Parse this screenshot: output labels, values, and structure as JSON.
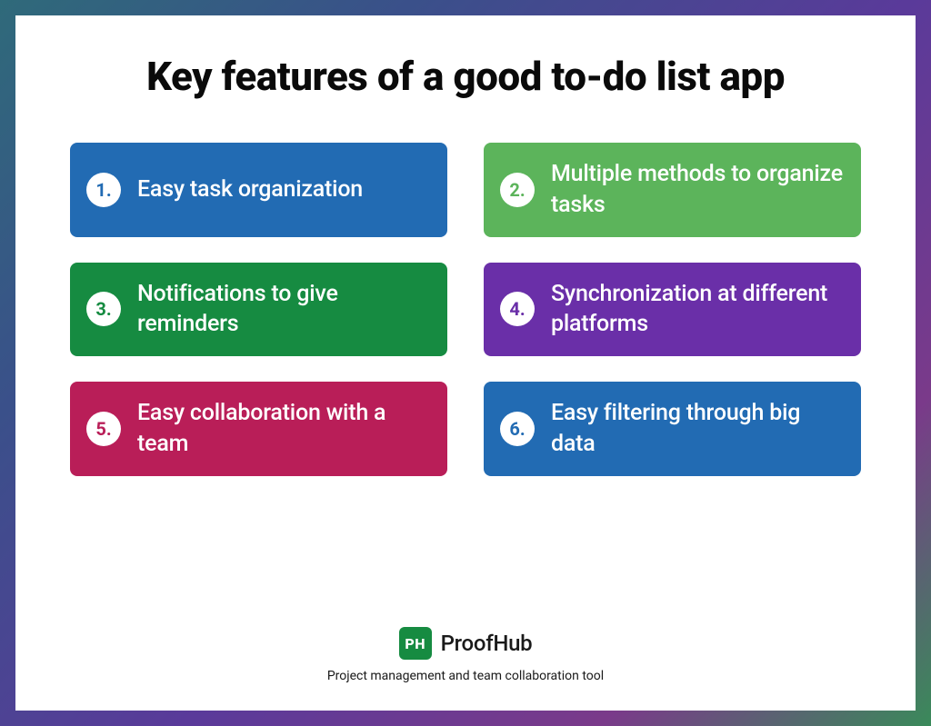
{
  "title": "Key features of a good to-do list app",
  "items": [
    {
      "n": "1.",
      "label": "Easy task organization",
      "bg": "#226bb3",
      "fg": "#226bb3"
    },
    {
      "n": "2.",
      "label": "Multiple methods to organize tasks",
      "bg": "#5cb45b",
      "fg": "#5cb45b"
    },
    {
      "n": "3.",
      "label": "Notifications to give reminders",
      "bg": "#168b41",
      "fg": "#168b41"
    },
    {
      "n": "4.",
      "label": "Synchronization at different platforms",
      "bg": "#6a2fa8",
      "fg": "#6a2fa8"
    },
    {
      "n": "5.",
      "label": "Easy collaboration with a team",
      "bg": "#b91e58",
      "fg": "#b91e58"
    },
    {
      "n": "6.",
      "label": "Easy filtering through big data",
      "bg": "#226bb3",
      "fg": "#226bb3"
    }
  ],
  "brand": {
    "badge": "PH",
    "name": "ProofHub",
    "tagline": "Project management and team collaboration tool"
  }
}
